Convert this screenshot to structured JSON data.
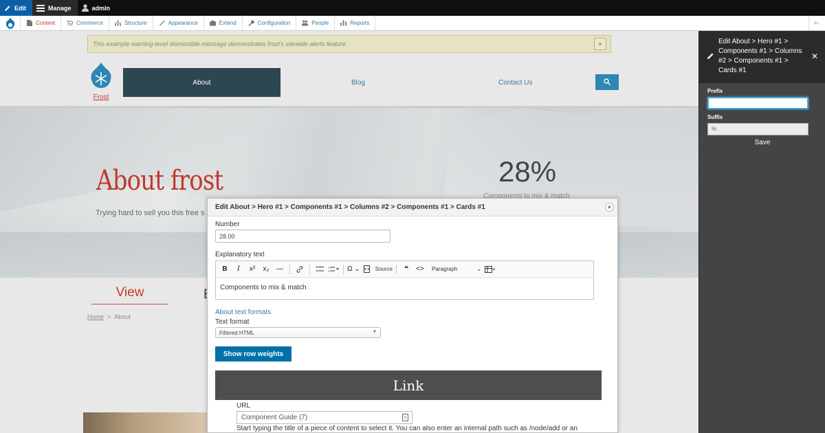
{
  "toolbar": {
    "edit_label": "Edit",
    "manage_label": "Manage",
    "user_label": "admin"
  },
  "tray": {
    "items": [
      {
        "label": "Content",
        "icon": "page-icon"
      },
      {
        "label": "Commerce",
        "icon": "cart-icon"
      },
      {
        "label": "Structure",
        "icon": "sitemap-icon"
      },
      {
        "label": "Appearance",
        "icon": "paintbrush-icon"
      },
      {
        "label": "Extend",
        "icon": "puzzle-icon"
      },
      {
        "label": "Configuration",
        "icon": "wrench-icon"
      },
      {
        "label": "People",
        "icon": "people-icon"
      },
      {
        "label": "Reports",
        "icon": "bar-chart-icon"
      }
    ]
  },
  "alert": {
    "message": "This example warning-level dismissible message demonstrates frost's sitewide alerts feature.",
    "close": "×"
  },
  "site": {
    "name": "Frost",
    "nav": {
      "about": "About",
      "blog": "Blog",
      "contact": "Contact Us"
    }
  },
  "hero": {
    "title": "About frost",
    "subtitle": "Trying hard to sell you this free s",
    "stat_value": "28%",
    "stat_label": "Components to mix & match"
  },
  "tabs": {
    "view": "View",
    "edit_partial": "E"
  },
  "breadcrumb": {
    "home": "Home",
    "sep": ">",
    "current": "About"
  },
  "modal": {
    "title": "Edit About > Hero #1 > Components #1 > Columns #2 > Components #1 > Cards #1",
    "close": "×",
    "number_label": "Number",
    "number_value": "28.00",
    "explanatory_label": "Explanatory text",
    "editor_source_label": "Source",
    "editor_format_select": "Paragraph",
    "editor_content": "Components to mix & match",
    "about_formats_link": "About text formats",
    "text_format_label": "Text format",
    "text_format_value": "Filtered HTML",
    "row_weights_button": "Show row weights",
    "link_banner": "Link",
    "url_label": "URL",
    "url_value": "Component Guide (7)",
    "url_help": "Start typing the title of a piece of content to select it. You can also enter an internal path such as /node/add or an"
  },
  "sidebar": {
    "title": "Edit About > Hero #1 > Components #1 > Columns #2 > Components #1 > Cards #1",
    "close": "✕",
    "prefix_label": "Prefix",
    "prefix_value": "",
    "suffix_label": "Suffix",
    "suffix_value": "%",
    "save_label": "Save"
  },
  "colors": {
    "accent": "#0071a8",
    "brand_red": "#c0392b",
    "nav_dark": "#2c4752",
    "toolbar_bg": "#0f0f0f"
  }
}
